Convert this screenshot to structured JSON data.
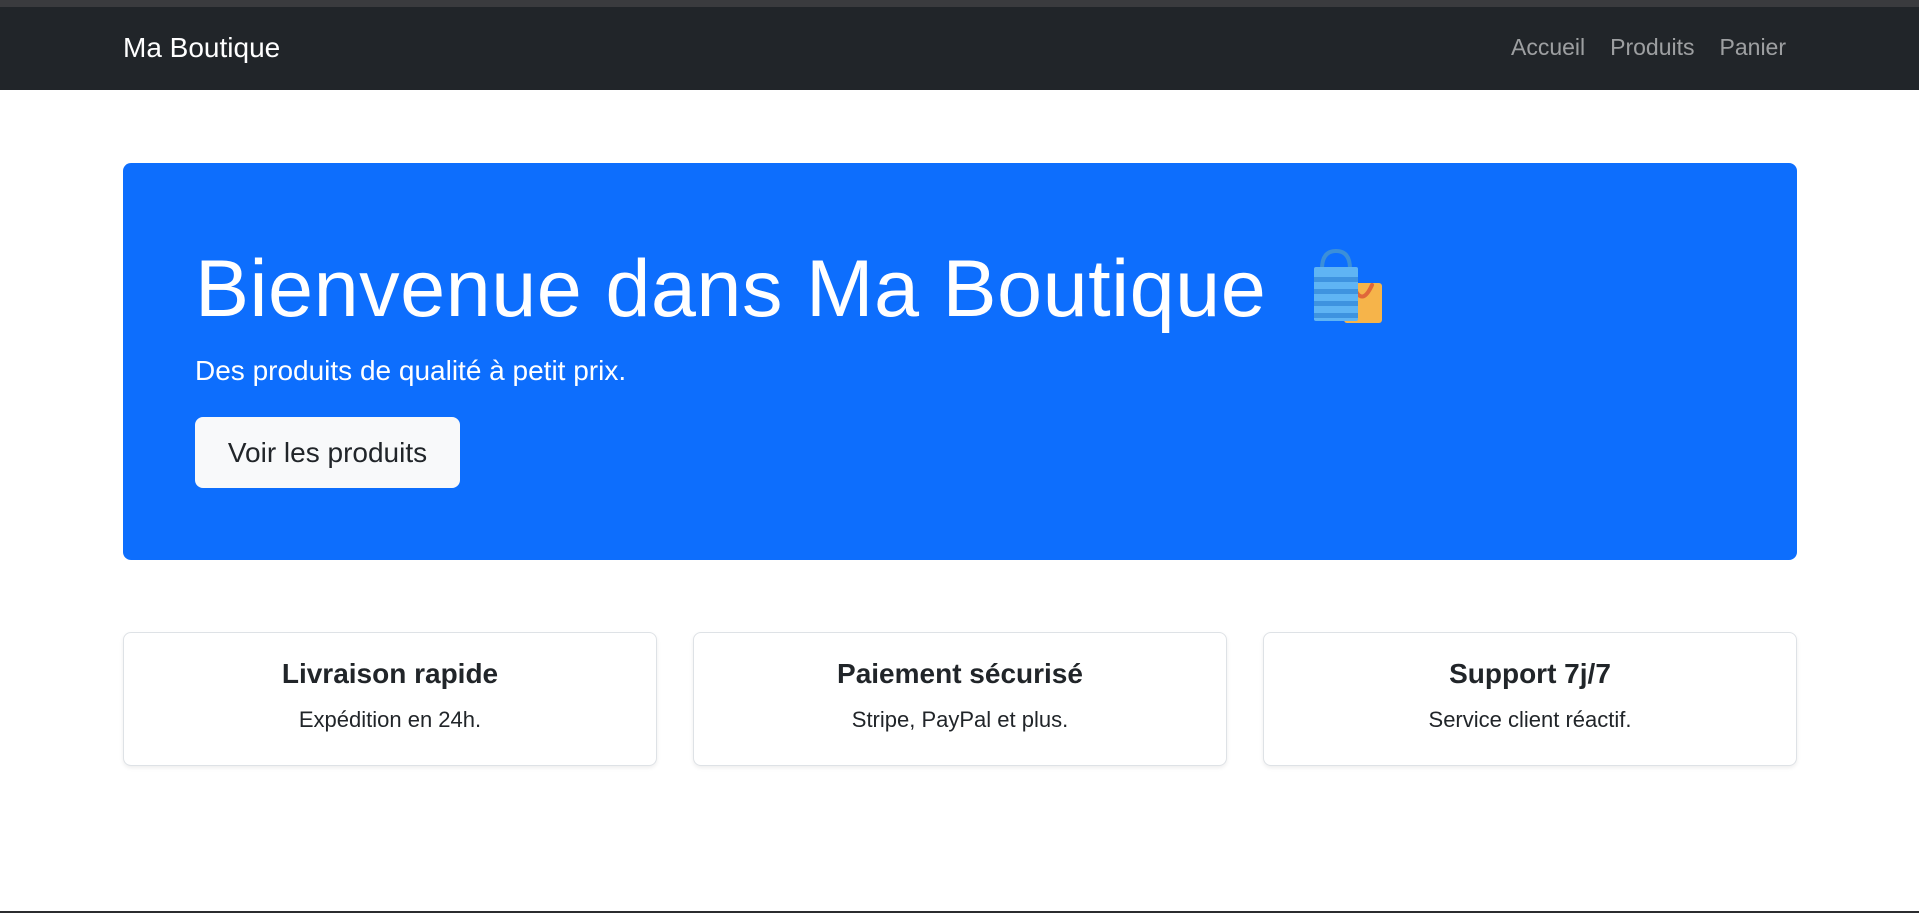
{
  "navbar": {
    "brand": "Ma Boutique",
    "links": [
      {
        "label": "Accueil"
      },
      {
        "label": "Produits"
      },
      {
        "label": "Panier"
      }
    ]
  },
  "hero": {
    "title": "Bienvenue dans Ma Boutique",
    "icon": "shopping-bags-emoji",
    "subtitle": "Des produits de qualité à petit prix.",
    "button_label": "Voir les produits"
  },
  "features": [
    {
      "title": "Livraison rapide",
      "text": "Expédition en 24h."
    },
    {
      "title": "Paiement sécurisé",
      "text": "Stripe, PayPal et plus."
    },
    {
      "title": "Support 7j/7",
      "text": "Service client réactif."
    }
  ],
  "colors": {
    "navbar_bg": "#212529",
    "hero_bg": "#0d6efd",
    "button_bg": "#f8f9fa",
    "card_border": "#dee2e6"
  }
}
